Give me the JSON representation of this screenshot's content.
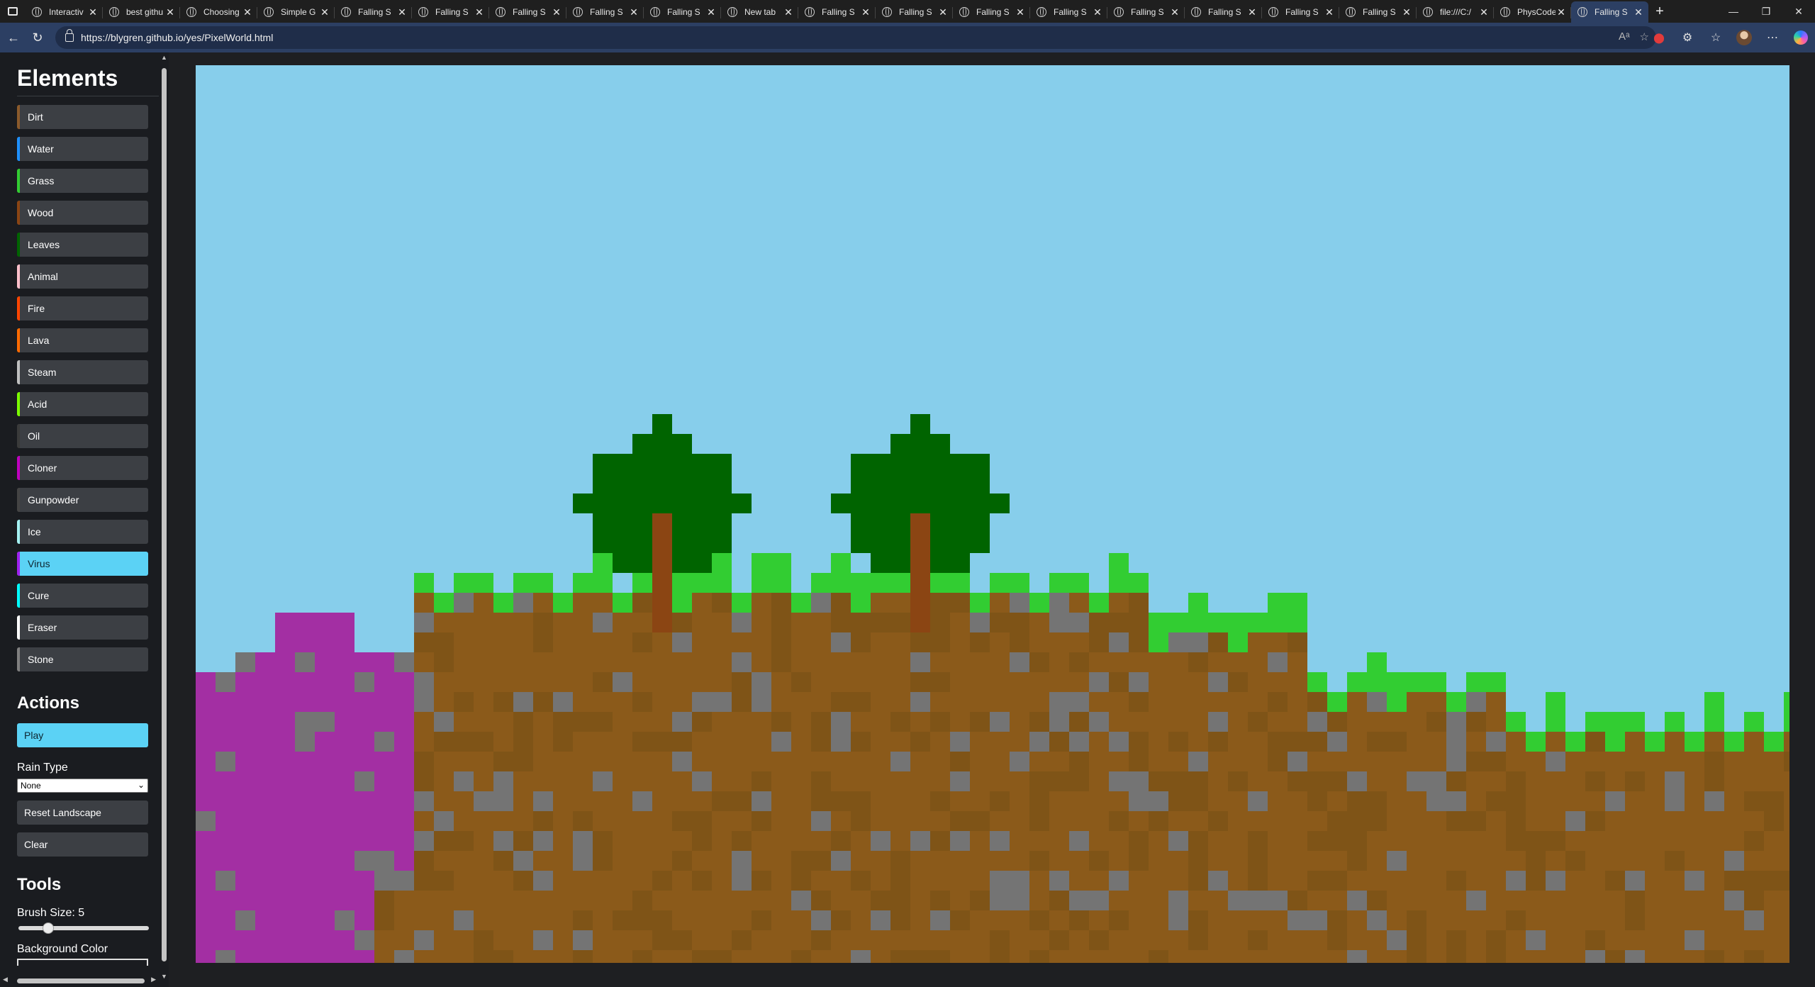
{
  "browser": {
    "tabs": [
      {
        "title": "Interactiv",
        "icon": "github-icon"
      },
      {
        "title": "best githu",
        "icon": "github-icon"
      },
      {
        "title": "Choosing",
        "icon": "copilot-icon"
      },
      {
        "title": "Simple G",
        "icon": "globe-icon"
      },
      {
        "title": "Falling S",
        "icon": "globe-icon"
      },
      {
        "title": "Falling S",
        "icon": "globe-icon"
      },
      {
        "title": "Falling S",
        "icon": "globe-icon"
      },
      {
        "title": "Falling S",
        "icon": "globe-icon"
      },
      {
        "title": "Falling S",
        "icon": "globe-icon"
      },
      {
        "title": "New tab",
        "icon": "newtab-icon"
      },
      {
        "title": "Falling S",
        "icon": "globe-icon"
      },
      {
        "title": "Falling S",
        "icon": "globe-icon"
      },
      {
        "title": "Falling S",
        "icon": "globe-icon"
      },
      {
        "title": "Falling S",
        "icon": "globe-icon"
      },
      {
        "title": "Falling S",
        "icon": "globe-icon"
      },
      {
        "title": "Falling S",
        "icon": "globe-icon"
      },
      {
        "title": "Falling S",
        "icon": "globe-icon"
      },
      {
        "title": "Falling S",
        "icon": "globe-icon"
      },
      {
        "title": "file:///C:/",
        "icon": "file-icon"
      },
      {
        "title": "PhysCode",
        "icon": "globe-icon"
      },
      {
        "title": "Falling S",
        "icon": "globe-icon",
        "active": true
      }
    ],
    "url": "https://blygren.github.io/yes/PixelWorld.html"
  },
  "sidebar": {
    "elements_title": "Elements",
    "elements": [
      {
        "label": "Dirt",
        "color": "#8b5a2b"
      },
      {
        "label": "Water",
        "color": "#1e90ff"
      },
      {
        "label": "Grass",
        "color": "#32cd32"
      },
      {
        "label": "Wood",
        "color": "#8b4513"
      },
      {
        "label": "Leaves",
        "color": "#006400"
      },
      {
        "label": "Animal",
        "color": "#ffc0cb"
      },
      {
        "label": "Fire",
        "color": "#ff4500"
      },
      {
        "label": "Lava",
        "color": "#ff6a00"
      },
      {
        "label": "Steam",
        "color": "#c0c0c0"
      },
      {
        "label": "Acid",
        "color": "#7cfc00"
      },
      {
        "label": "Oil",
        "color": "#3a3a3a"
      },
      {
        "label": "Cloner",
        "color": "#c000c0"
      },
      {
        "label": "Gunpowder",
        "color": "#444444"
      },
      {
        "label": "Ice",
        "color": "#a5f2f3"
      },
      {
        "label": "Virus",
        "color": "#a020f0",
        "active": true
      },
      {
        "label": "Cure",
        "color": "#00ffff"
      },
      {
        "label": "Eraser",
        "color": "#ffffff"
      },
      {
        "label": "Stone",
        "color": "#808080"
      }
    ],
    "actions_title": "Actions",
    "play_label": "Play",
    "rain_label": "Rain Type",
    "rain_value": "None",
    "reset_label": "Reset Landscape",
    "clear_label": "Clear",
    "tools_title": "Tools",
    "brush_label": "Brush Size: 5",
    "brush_fraction": 0.2,
    "bg_label": "Background Color"
  },
  "world": {
    "sky_color": "#87ceeb",
    "dirt_color": "#8b5a1a",
    "grass_color": "#32cd32",
    "stone_color": "#747474",
    "virus_color": "#a32fa3",
    "leaves_color": "#006400",
    "wood_color": "#8b4513"
  }
}
